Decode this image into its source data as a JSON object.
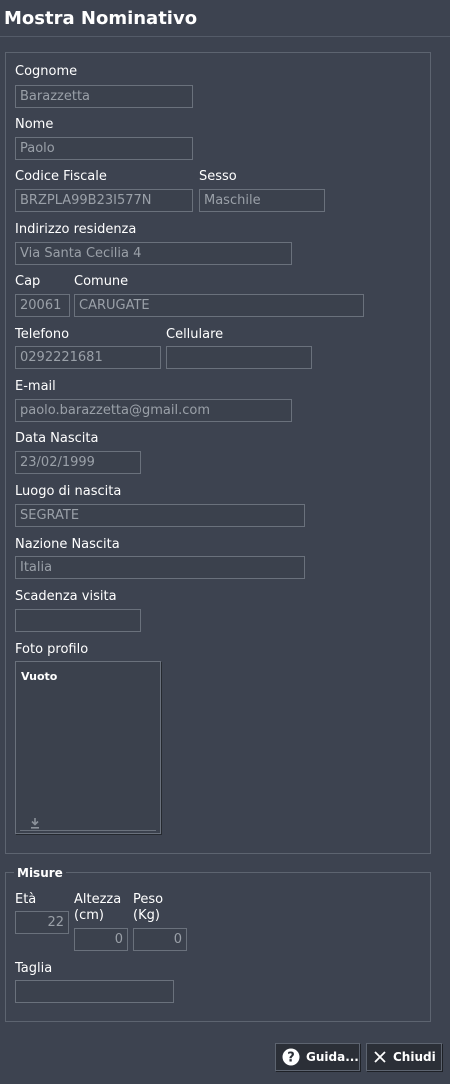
{
  "window": {
    "title": "Mostra Nominativo"
  },
  "anagrafica": {
    "cognome": {
      "label": "Cognome",
      "value": "Barazzetta"
    },
    "nome": {
      "label": "Nome",
      "value": "Paolo"
    },
    "codice_fiscale": {
      "label": "Codice Fiscale",
      "value": "BRZPLA99B23I577N"
    },
    "sesso": {
      "label": "Sesso",
      "value": "Maschile"
    },
    "indirizzo": {
      "label": "Indirizzo residenza",
      "value": "Via Santa Cecilia 4"
    },
    "cap": {
      "label": "Cap",
      "value": "20061"
    },
    "comune": {
      "label": "Comune",
      "value": "CARUGATE"
    },
    "telefono": {
      "label": "Telefono",
      "value": "0292221681"
    },
    "cellulare": {
      "label": "Cellulare",
      "value": ""
    },
    "email": {
      "label": "E-mail",
      "value": "paolo.barazzetta@gmail.com"
    },
    "data_nascita": {
      "label": "Data Nascita",
      "value": "23/02/1999"
    },
    "luogo_nascita": {
      "label": "Luogo di nascita",
      "value": "SEGRATE"
    },
    "nazione_nascita": {
      "label": "Nazione Nascita",
      "value": "Italia"
    },
    "scadenza_visita": {
      "label": "Scadenza visita",
      "value": ""
    },
    "foto": {
      "label": "Foto profilo",
      "placeholder": "Vuoto",
      "icon": "download-icon"
    }
  },
  "misure": {
    "legend": "Misure",
    "eta": {
      "label": "Età",
      "value": "22"
    },
    "altezza": {
      "label_line1": "Altezza",
      "label_line2": "(cm)",
      "value": "0"
    },
    "peso": {
      "label_line1": "Peso",
      "label_line2": "(Kg)",
      "value": "0"
    },
    "taglia": {
      "label": "Taglia",
      "value": ""
    }
  },
  "buttons": {
    "guida": {
      "label": "Guida...",
      "icon": "help-icon"
    },
    "chiudi": {
      "label": "Chiudi",
      "icon": "close-icon"
    }
  },
  "colors": {
    "background": "#3d4350",
    "input_bg": "#3b414d",
    "input_border": "#6a717c",
    "input_text": "#9aa0a8"
  }
}
